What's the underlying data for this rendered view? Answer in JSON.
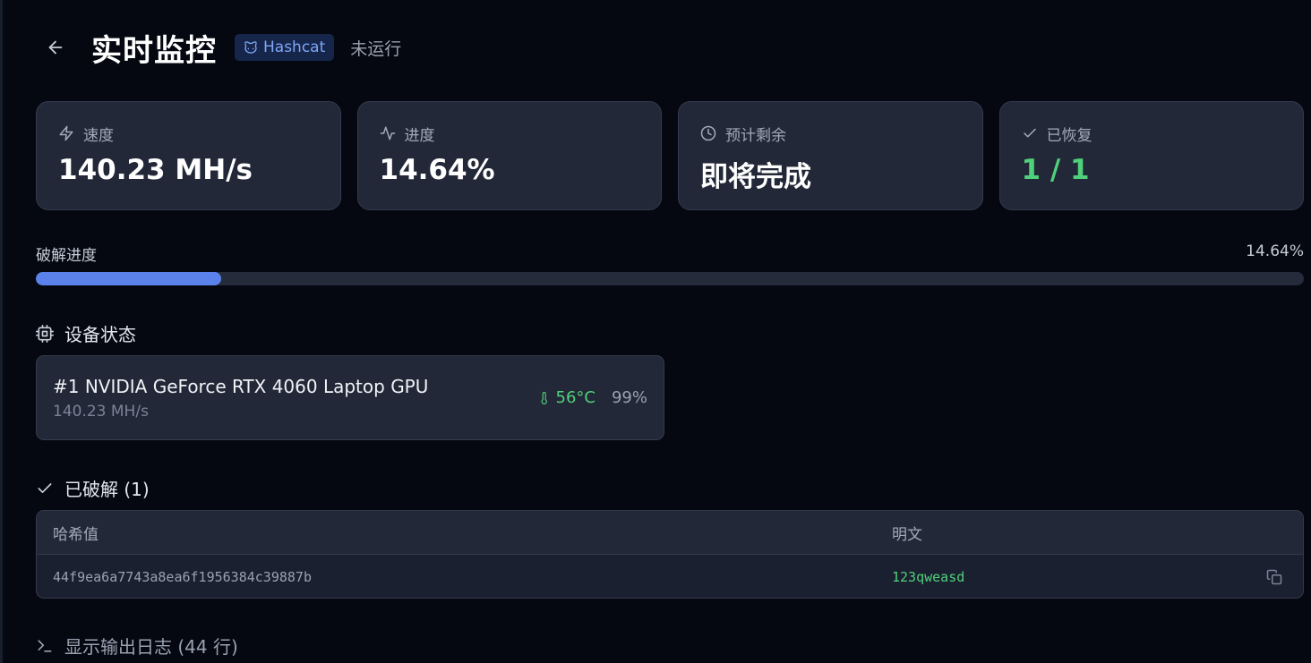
{
  "header": {
    "title": "实时监控",
    "tool_badge": "Hashcat",
    "status": "未运行"
  },
  "stats": [
    {
      "label": "速度",
      "value": "140.23 MH/s",
      "icon": "zap-icon"
    },
    {
      "label": "进度",
      "value": "14.64%",
      "icon": "activity-icon"
    },
    {
      "label": "预计剩余",
      "value": "即将完成",
      "icon": "clock-icon"
    },
    {
      "label": "已恢复",
      "value": "1 / 1",
      "icon": "check-icon",
      "accent": "#4fd07a"
    }
  ],
  "progress": {
    "label": "破解进度",
    "percent_text": "14.64%",
    "fraction": 0.1464,
    "fill_color": "#5b82ea"
  },
  "devices": {
    "title": "设备状态",
    "items": [
      {
        "name": "#1 NVIDIA GeForce RTX 4060 Laptop GPU",
        "speed": "140.23 MH/s",
        "temperature": "56°C",
        "utilization": "99%"
      }
    ]
  },
  "cracked": {
    "title": "已破解 (1)",
    "columns": [
      "哈希值",
      "明文"
    ],
    "rows": [
      {
        "hash": "44f9ea6a7743a8ea6f1956384c39887b",
        "plain": "123qweasd"
      }
    ]
  },
  "log_toggle": {
    "label": "显示输出日志 (44 行)"
  },
  "colors": {
    "background": "#050811",
    "card": "#232838",
    "accent_blue": "#5b82ea",
    "success_green": "#4fd07a"
  }
}
